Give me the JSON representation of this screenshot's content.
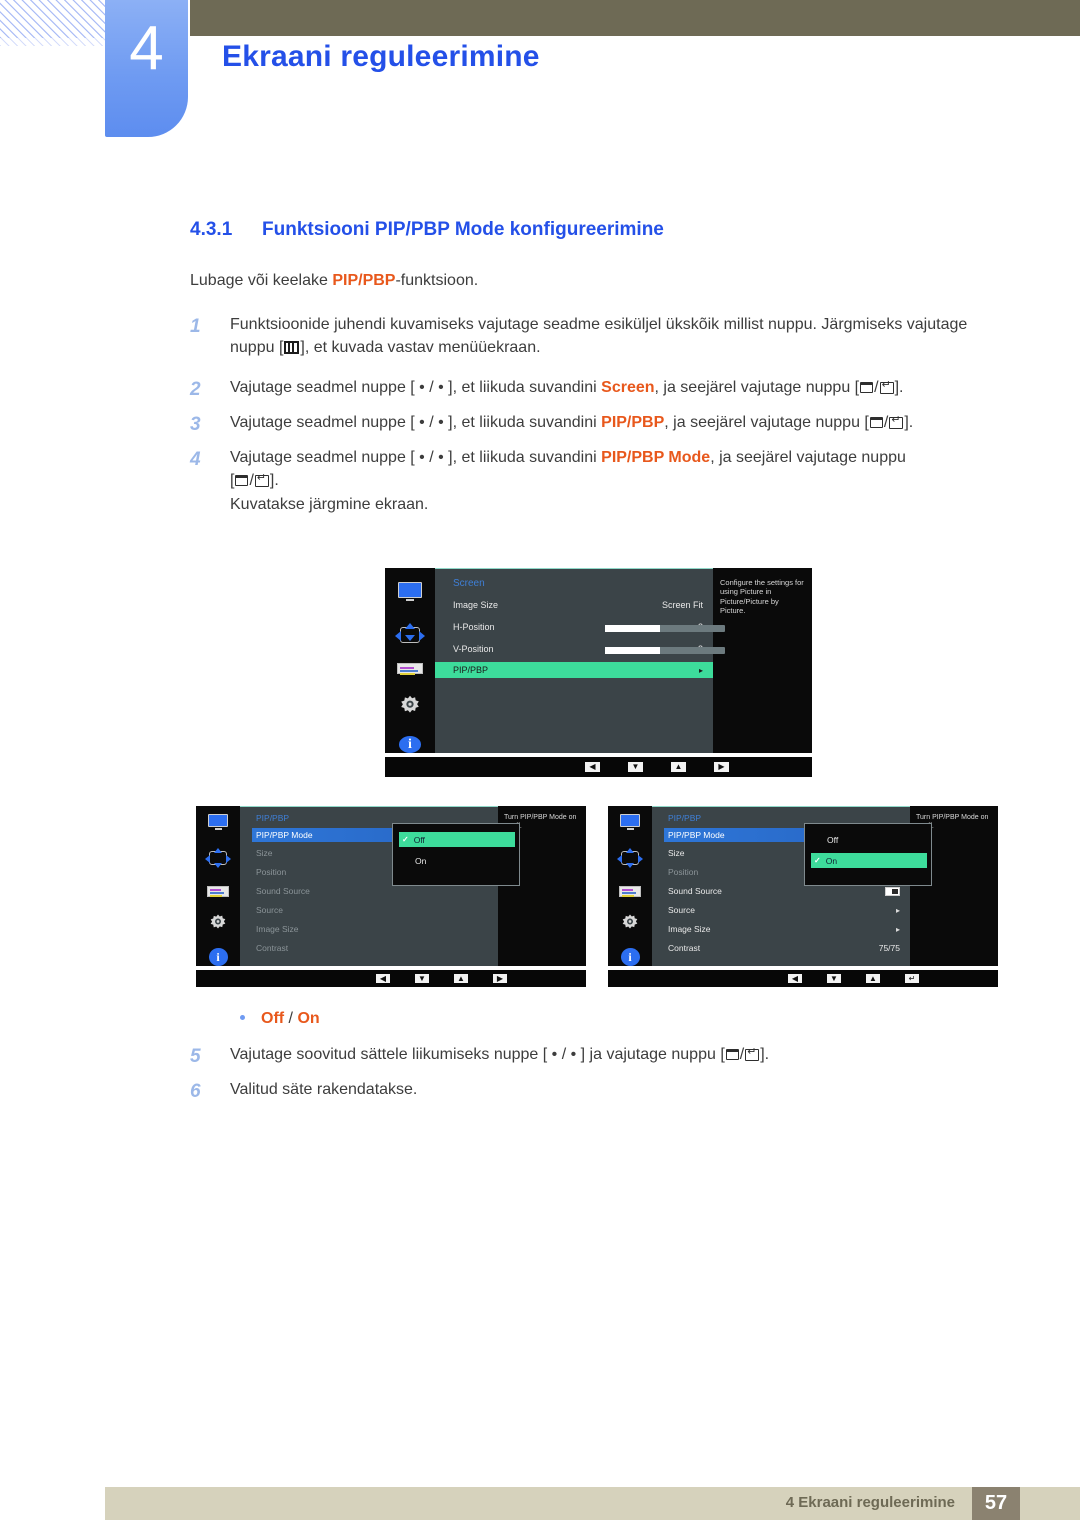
{
  "header": {
    "chapter_number": "4",
    "chapter_title": "Ekraani reguleerimine"
  },
  "section": {
    "number": "4.3.1",
    "title": "Funktsiooni PIP/PBP Mode konfigureerimine",
    "intro_before": "Lubage või keelake ",
    "intro_highlight": "PIP/PBP",
    "intro_after": "-funktsioon."
  },
  "steps": {
    "s1": {
      "num": "1",
      "part1": "Funktsioonide juhendi kuvamiseks vajutage seadme esiküljel ükskõik millist nuppu. Järgmiseks vajutage nuppu [",
      "part2": "], et kuvada vastav menüüekraan."
    },
    "s2": {
      "num": "2",
      "part1": "Vajutage seadmel nuppe [ • / • ], et liikuda suvandini ",
      "highlight": "Screen",
      "part2": ", ja seejärel vajutage nuppu [",
      "part3": "]."
    },
    "s3": {
      "num": "3",
      "part1": "Vajutage seadmel nuppe [ • / • ], et liikuda suvandini ",
      "highlight": "PIP/PBP",
      "part2": ", ja seejärel vajutage nuppu [",
      "part3": "]."
    },
    "s4": {
      "num": "4",
      "part1": "Vajutage seadmel nuppe [ • / • ], et liikuda suvandini ",
      "highlight": "PIP/PBP Mode",
      "part2": ", ja seejärel vajutage nuppu",
      "part3": "[",
      "part4": "].",
      "note": "Kuvatakse järgmine ekraan."
    },
    "s5": {
      "num": "5",
      "part1": "Vajutage soovitud sättele liikumiseks nuppe [ • / • ] ja vajutage nuppu [",
      "part2": "]."
    },
    "s6": {
      "num": "6",
      "part1": "Valitud säte rakendatakse."
    }
  },
  "option_bullet": {
    "off": "Off",
    "separator": " / ",
    "on": "On"
  },
  "osd1": {
    "title": "Screen",
    "rows": [
      {
        "label": "Image Size",
        "value": "Screen Fit",
        "type": "value"
      },
      {
        "label": "H-Position",
        "value": "3",
        "type": "slider",
        "fill": 46
      },
      {
        "label": "V-Position",
        "value": "3",
        "type": "slider",
        "fill": 46
      },
      {
        "label": "PIP/PBP",
        "value": "▸",
        "type": "selected"
      }
    ],
    "help": "Configure the settings for using Picture in Picture/Picture by Picture.",
    "nav": [
      "◀",
      "▼",
      "▲",
      "▶"
    ]
  },
  "osd2": {
    "title": "PIP/PBP",
    "rows": [
      {
        "label": "PIP/PBP Mode",
        "state": "highlight"
      },
      {
        "label": "Size",
        "state": "dim"
      },
      {
        "label": "Position",
        "state": "dim"
      },
      {
        "label": "Sound Source",
        "state": "dim"
      },
      {
        "label": "Source",
        "state": "dim"
      },
      {
        "label": "Image Size",
        "state": "dim"
      },
      {
        "label": "Contrast",
        "state": "dim"
      }
    ],
    "popup": [
      {
        "label": "Off",
        "selected": true
      },
      {
        "label": "On",
        "selected": false
      }
    ],
    "help": "Turn PIP/PBP Mode on or off.",
    "nav": [
      "◀",
      "▼",
      "▲",
      "▶"
    ]
  },
  "osd3": {
    "title": "PIP/PBP",
    "rows": [
      {
        "label": "PIP/PBP Mode",
        "state": "highlight",
        "value": ""
      },
      {
        "label": "Size",
        "state": "normal",
        "value": ""
      },
      {
        "label": "Position",
        "state": "dim",
        "value": ""
      },
      {
        "label": "Sound Source",
        "state": "normal",
        "value": "toggle"
      },
      {
        "label": "Source",
        "state": "normal",
        "value": "▸"
      },
      {
        "label": "Image Size",
        "state": "normal",
        "value": "▸"
      },
      {
        "label": "Contrast",
        "state": "normal",
        "value": "75/75"
      }
    ],
    "popup": [
      {
        "label": "Off",
        "selected": false
      },
      {
        "label": "On",
        "selected": true
      }
    ],
    "help": "Turn PIP/PBP Mode on or off.",
    "nav": [
      "◀",
      "▼",
      "▲",
      "↵"
    ]
  },
  "footer": {
    "text": "4 Ekraani reguleerimine",
    "page": "57"
  },
  "colors": {
    "accent_blue": "#2450e8",
    "highlight_orange": "#e8581c",
    "olive": "#6e6a55",
    "tab_blue": "#6f9bf2",
    "footer_bg": "#d6d2bc",
    "page_box": "#8b8270",
    "osd_green": "#3ddc9b"
  }
}
